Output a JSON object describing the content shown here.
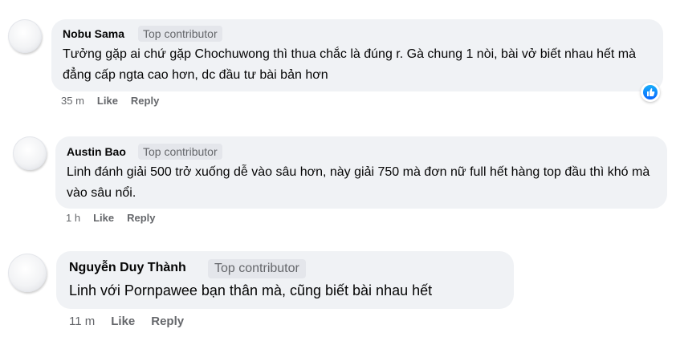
{
  "comments": [
    {
      "author": "Nobu Sama",
      "badge": "Top contributor",
      "text": "Tưởng gặp ai chứ gặp Chochuwong thì thua chắc là đúng r. Gà chung 1 nòi, bài vở biết nhau hết mà đẳng cấp ngta cao hơn, dc đầu tư bài bản hơn",
      "time": "35 m",
      "like": "Like",
      "reply": "Reply",
      "reaction_icon": "thumbs-up-icon"
    },
    {
      "author": "Austin Bao",
      "badge": "Top contributor",
      "text": "Linh đánh giải 500 trở xuống dễ vào sâu hơn, này giải 750 mà đơn nữ full hết hàng top đầu thì khó mà vào sâu nổi.",
      "time": "1 h",
      "like": "Like",
      "reply": "Reply"
    },
    {
      "author": "Nguyễn Duy Thành",
      "badge": "Top contributor",
      "text": "Linh với Pornpawee bạn thân mà, cũng biết bài nhau hết",
      "time": "11 m",
      "like": "Like",
      "reply": "Reply"
    }
  ],
  "colors": {
    "bubble": "#f0f2f5",
    "badge_bg": "#e4e6eb",
    "meta_text": "#65676b",
    "like_blue": "#0866ff"
  }
}
